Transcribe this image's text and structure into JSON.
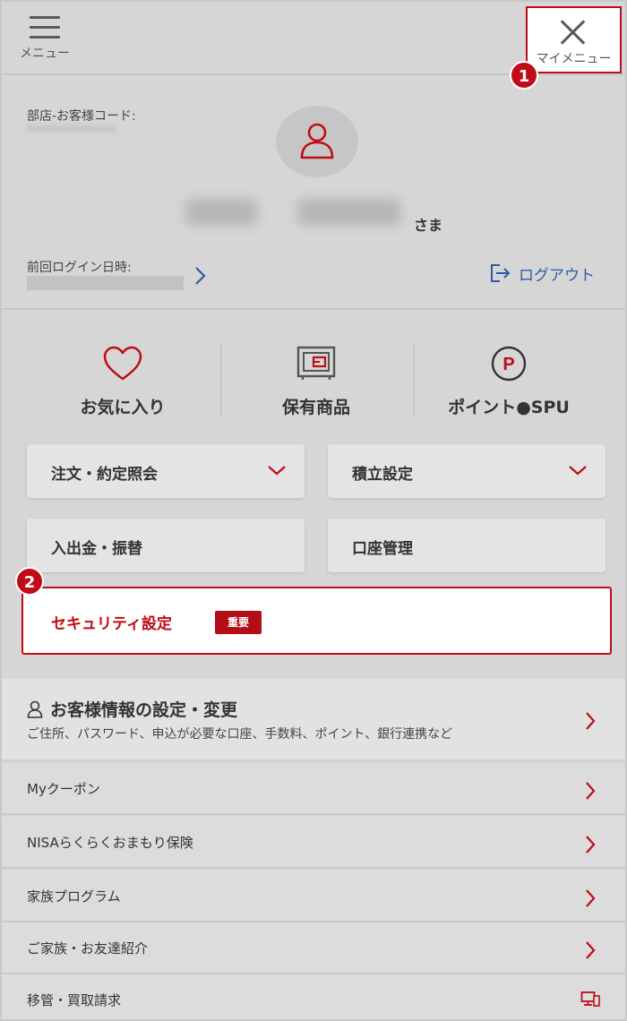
{
  "header": {
    "menu_label": "メニュー",
    "close_label": "マイメニュー"
  },
  "annotations": {
    "badge1": "1",
    "badge2": "2"
  },
  "profile": {
    "code_label": "部店-お客様コード:",
    "honorific": "さま",
    "last_login_label": "前回ログイン日時:",
    "logout_label": "ログアウト"
  },
  "quick_links": [
    {
      "label": "お気に入り",
      "icon": "heart-icon"
    },
    {
      "label": "保有商品",
      "icon": "safe-icon"
    },
    {
      "label": "ポイント●SPU",
      "icon": "point-p-icon"
    }
  ],
  "grid_buttons": {
    "orders": "注文・約定照会",
    "accumulation": "積立設定",
    "deposit": "入出金・振替",
    "account": "口座管理"
  },
  "security": {
    "label": "セキュリティ設定",
    "tag": "重要"
  },
  "customer_info": {
    "title": "お客様情報の設定・変更",
    "description": "ご住所、パスワード、申込が必要な口座、手数料、ポイント、銀行連携など"
  },
  "list": [
    {
      "label": "Myクーポン"
    },
    {
      "label": "NISAらくらくおまもり保険"
    },
    {
      "label": "家族プログラム"
    },
    {
      "label": "ご家族・お友達紹介"
    },
    {
      "label": "移管・買取請求"
    }
  ],
  "colors": {
    "brand_red": "#c00c17",
    "link_blue": "#2f5aa8",
    "overlay_gray": "#d6d6d6"
  }
}
